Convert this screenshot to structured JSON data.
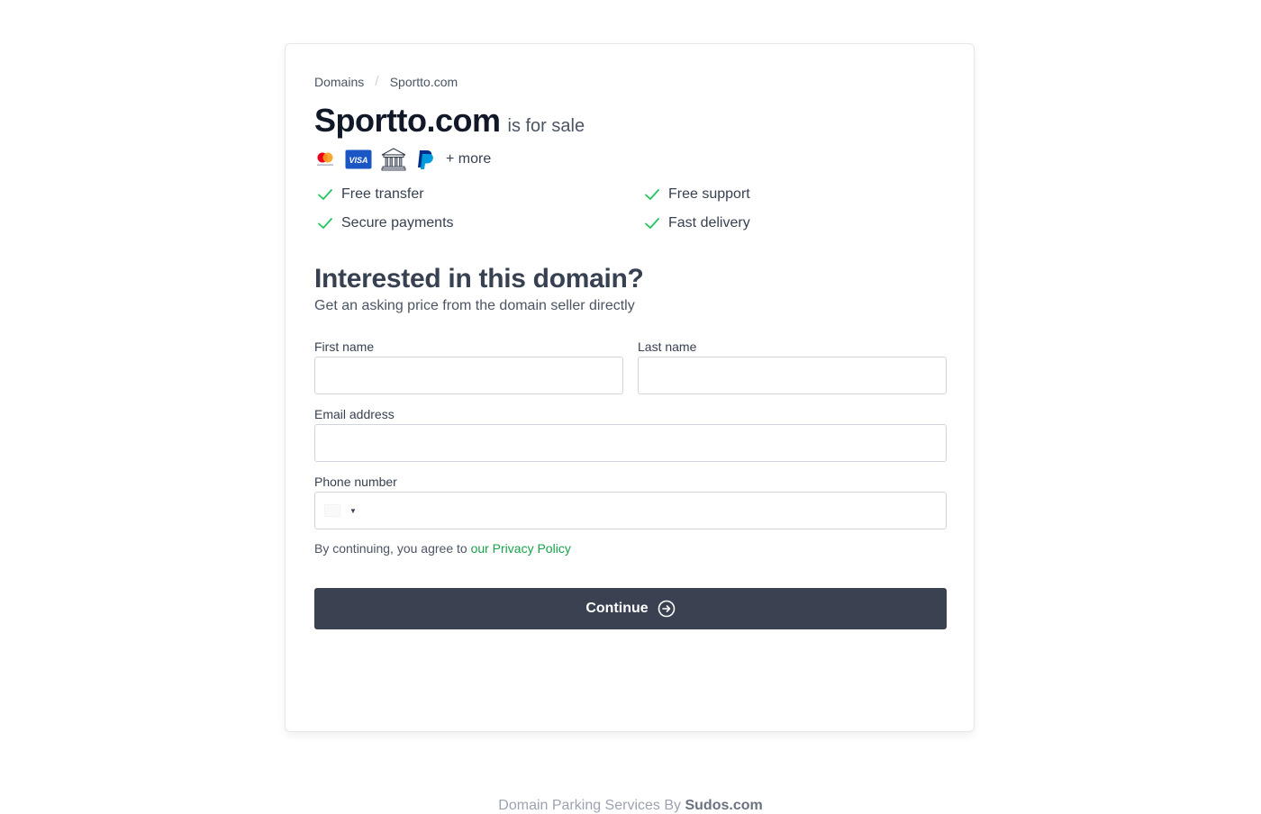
{
  "breadcrumb": {
    "items": [
      "Domains",
      "Sportto.com"
    ],
    "separator": "/"
  },
  "header": {
    "domain": "Sportto.com",
    "status": "is for sale"
  },
  "payments": {
    "icons": [
      "mastercard-icon",
      "visa-icon",
      "bank-icon",
      "paypal-icon"
    ],
    "visa_text": "VISA",
    "more_label": "+ more"
  },
  "features": [
    "Free transfer",
    "Free support",
    "Secure payments",
    "Fast delivery"
  ],
  "form": {
    "heading": "Interested in this domain?",
    "subheading": "Get an asking price from the domain seller directly",
    "first_name": {
      "label": "First name",
      "value": ""
    },
    "last_name": {
      "label": "Last name",
      "value": ""
    },
    "email": {
      "label": "Email address",
      "value": ""
    },
    "phone": {
      "label": "Phone number",
      "value": ""
    },
    "consent_text": "By continuing, you agree to",
    "consent_link": "our Privacy Policy",
    "submit_label": "Continue"
  },
  "footer": {
    "text": "Domain Parking Services By",
    "brand": "Sudos.com"
  },
  "colors": {
    "accent": "#16a34a",
    "button": "#3a4252",
    "check": "#22c55e"
  }
}
